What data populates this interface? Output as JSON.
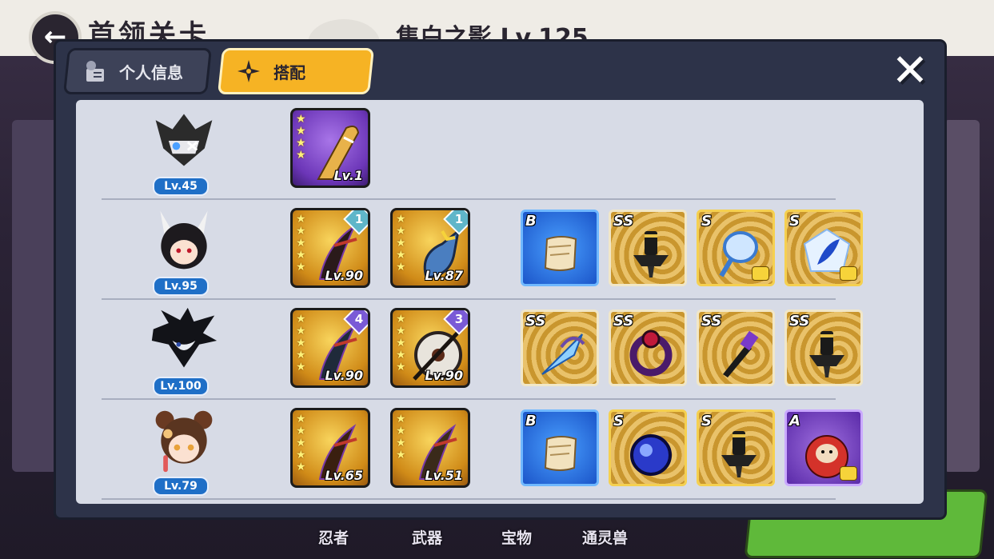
{
  "background": {
    "page_title": "首领关卡",
    "player_name": "隼白之影 Lv.125",
    "nav": [
      {
        "label": "忍者"
      },
      {
        "label": "武器"
      },
      {
        "label": "宝物"
      },
      {
        "label": "通灵兽"
      }
    ]
  },
  "tabs": [
    {
      "label": "个人信息",
      "icon": "profile-card-icon",
      "active": false
    },
    {
      "label": "搭配",
      "icon": "shuriken-icon",
      "active": true
    }
  ],
  "close_icon": "close-icon",
  "rows": [
    {
      "character": {
        "level": "Lv.45",
        "color": "#2b2b2b"
      },
      "weapons": [
        {
          "level": "Lv.1",
          "stars": [
            "★",
            "★",
            "★",
            "★"
          ],
          "rarity": "purple",
          "badge": ""
        }
      ],
      "items": []
    },
    {
      "character": {
        "level": "Lv.95",
        "color": "#1d1a1e"
      },
      "weapons": [
        {
          "level": "Lv.90",
          "stars": [
            "★",
            "★",
            "★",
            "★",
            "★"
          ],
          "rarity": "gold",
          "badge": "1",
          "badge_color": "teal"
        },
        {
          "level": "Lv.87",
          "stars": [
            "★",
            "★",
            "★",
            "★",
            "★"
          ],
          "rarity": "gold",
          "badge": "1",
          "badge_color": "teal"
        }
      ],
      "items": [
        {
          "grade": "B",
          "type": "b",
          "icon": "scroll-icon",
          "corner": false
        },
        {
          "grade": "SS",
          "type": "ss",
          "icon": "scroll-handle-icon",
          "corner": false
        },
        {
          "grade": "S",
          "type": "s",
          "icon": "mirror-icon",
          "corner": true
        },
        {
          "grade": "S",
          "type": "s",
          "icon": "feather-crystal-icon",
          "corner": true
        }
      ]
    },
    {
      "character": {
        "level": "Lv.100",
        "color": "#121318"
      },
      "weapons": [
        {
          "level": "Lv.90",
          "stars": [
            "★",
            "★",
            "★",
            "★",
            "★"
          ],
          "rarity": "gold",
          "badge": "4",
          "badge_color": "purple"
        },
        {
          "level": "Lv.90",
          "stars": [
            "★",
            "★",
            "★",
            "★",
            "★"
          ],
          "rarity": "gold",
          "badge": "3",
          "badge_color": "purple"
        }
      ],
      "items": [
        {
          "grade": "SS",
          "type": "ss",
          "icon": "crystal-bundle-icon",
          "corner": false
        },
        {
          "grade": "SS",
          "type": "ss",
          "icon": "dark-ring-icon",
          "corner": false
        },
        {
          "grade": "SS",
          "type": "ss",
          "icon": "purple-dagger-icon",
          "corner": false
        },
        {
          "grade": "SS",
          "type": "ss",
          "icon": "scroll-handle-icon",
          "corner": false
        }
      ]
    },
    {
      "character": {
        "level": "Lv.79",
        "color": "#5a3520"
      },
      "weapons": [
        {
          "level": "Lv.65",
          "stars": [
            "★",
            "★",
            "★",
            "★",
            "★"
          ],
          "rarity": "gold",
          "badge": ""
        },
        {
          "level": "Lv.51",
          "stars": [
            "★",
            "★",
            "★",
            "★"
          ],
          "rarity": "gold",
          "badge": ""
        }
      ],
      "items": [
        {
          "grade": "B",
          "type": "b",
          "icon": "scroll-icon",
          "corner": false
        },
        {
          "grade": "S",
          "type": "s",
          "icon": "dark-orb-icon",
          "corner": false
        },
        {
          "grade": "S",
          "type": "s",
          "icon": "scroll-handle-icon",
          "corner": false
        },
        {
          "grade": "A",
          "type": "a",
          "icon": "daruma-icon",
          "corner": true
        }
      ]
    }
  ]
}
